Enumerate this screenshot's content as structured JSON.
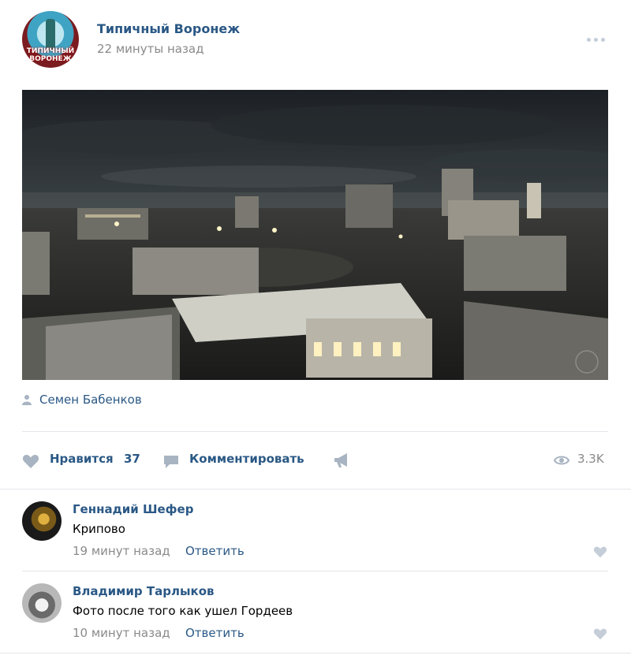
{
  "post": {
    "community_name": "Типичный Воронеж",
    "avatar_text": "ТИПИЧНЫЙ ВОРОНЕЖ",
    "time": "22 минуты назад",
    "author": "Семен Бабенков"
  },
  "actions": {
    "like_label": "Нравится",
    "like_count": "37",
    "comment_label": "Комментировать",
    "views": "3.3K"
  },
  "comments": [
    {
      "author": "Геннадий Шефер",
      "text": "Крипово",
      "time": "19 минут назад",
      "reply_label": "Ответить"
    },
    {
      "author": "Владимир Тарлыков",
      "text": "Фото после того как ушел Гордеев",
      "time": "10 минут назад",
      "reply_label": "Ответить"
    }
  ],
  "icons": {
    "more": "more-dots-icon",
    "author": "person-icon",
    "like": "heart-icon",
    "comment": "comment-bubble-icon",
    "share": "megaphone-icon",
    "views": "eye-icon"
  },
  "colors": {
    "link": "#2a5885",
    "muted": "#8a8a8a",
    "icon": "#c4cdd8",
    "divider": "#e4e6ea"
  }
}
